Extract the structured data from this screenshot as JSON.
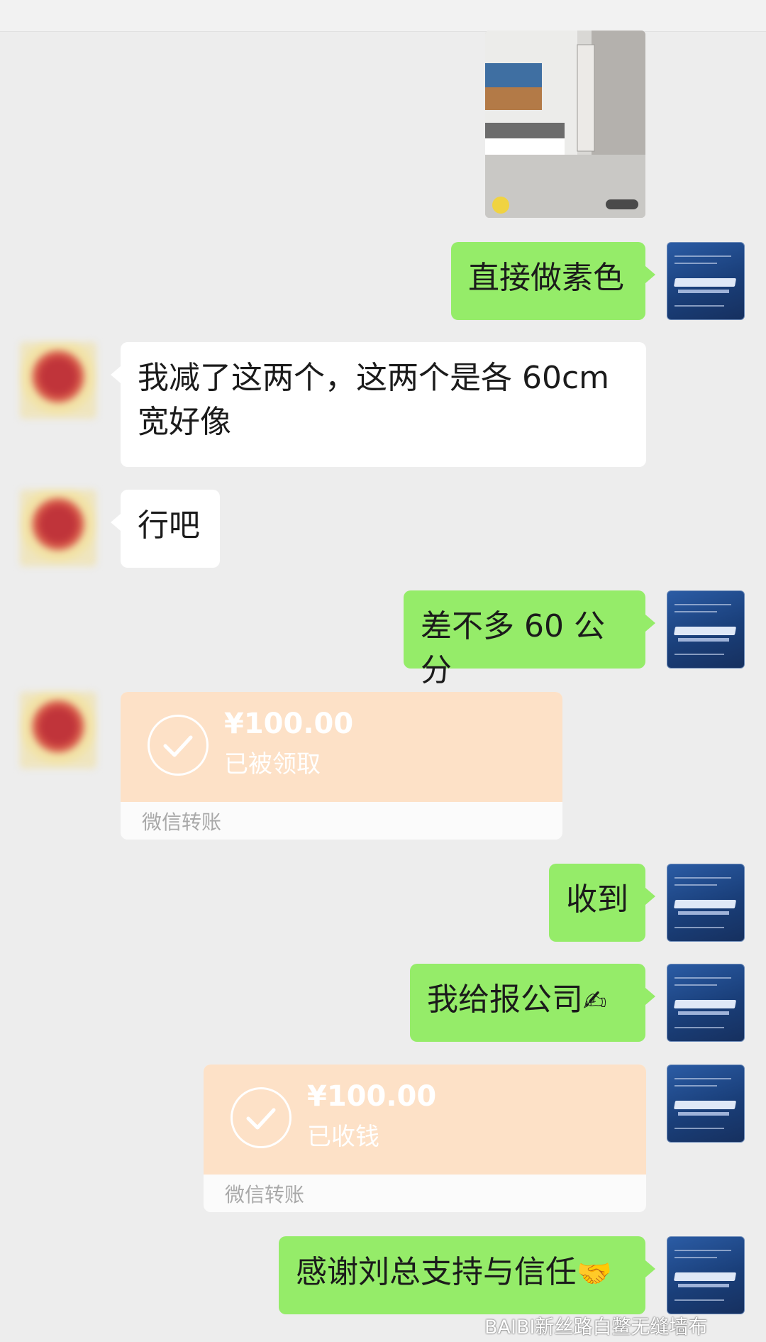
{
  "messages": {
    "m1": "直接做素色",
    "m2": "我减了这两个，这两个是各 60cm 宽好像",
    "m3": "行吧",
    "m4": "差不多 60 公分",
    "m5": "收到",
    "m6": "我给报公司",
    "m7": "感谢刘总支持与信任"
  },
  "transfer1": {
    "amount": "¥100.00",
    "status": "已被领取",
    "footer": "微信转账"
  },
  "transfer2": {
    "amount": "¥100.00",
    "status": "已收钱",
    "footer": "微信转账"
  },
  "emoji": {
    "hand": "✍",
    "handshake": "🤝"
  },
  "watermark": "BAIBI新丝路白鳖无缝墙布",
  "colors": {
    "green_bubble": "#95ec69",
    "transfer": "#fde1c7",
    "background": "#ededed"
  }
}
